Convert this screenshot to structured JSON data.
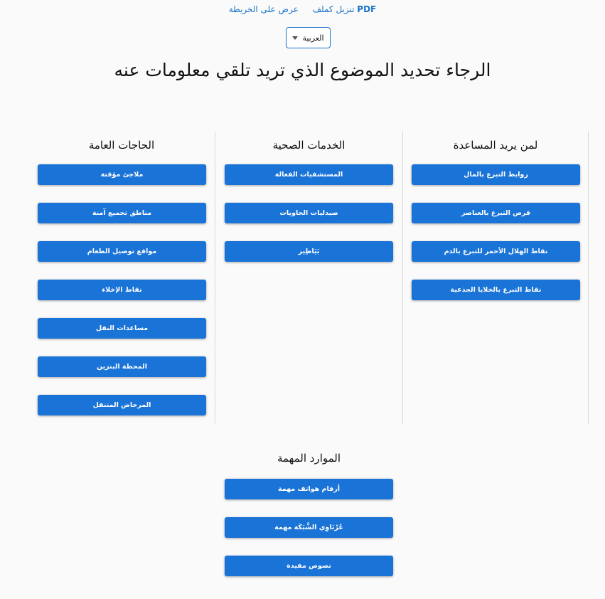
{
  "top_links": {
    "download_prefix": "PDF",
    "download_label": "تنزيل كملف",
    "map_label": "عرض على الخريطة"
  },
  "language": {
    "selected": "العربية"
  },
  "page_title": "الرجاء تحديد الموضوع الذي تريد تلقي معلومات عنه",
  "sections": {
    "help": {
      "title": "لمن يريد المساعدة",
      "buttons": [
        "روابط التبرع بالمال",
        "فرص التبرع بالعناصر",
        "نقاط الهلال الأحمر للتبرع بالدم",
        "نقاط التبرع بالخلايا الجذعية"
      ]
    },
    "health": {
      "title": "الخدمات الصحية",
      "buttons": [
        "المستشفيات الفعالة",
        "صيدليات الحاويات",
        "بَيَاطِير"
      ]
    },
    "general": {
      "title": "الحاجات العامة",
      "buttons": [
        "ملاجئ مؤقتة",
        "مناطق تجميع آمنة",
        "مواقع توصيل الطعام",
        "نقاط الإخلاء",
        "مساعدات النقل",
        "المحطة البنزين",
        "المرحاض المتنقل"
      ]
    },
    "resources": {
      "title": "الموارد المهمة",
      "buttons": [
        "أرقام هواتف مهمة",
        "عُرْنَاوِي الشَّبَكَة مهمة",
        "نصوص مفيدة"
      ]
    }
  }
}
